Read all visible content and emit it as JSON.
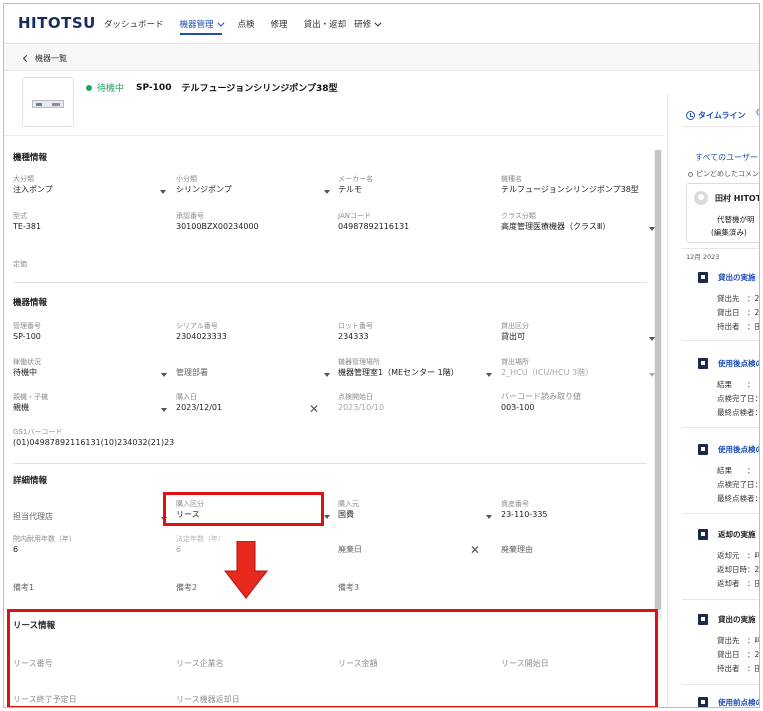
{
  "header": {
    "logo": "HITOTSU",
    "nav": [
      {
        "label": "ダッシュボード"
      },
      {
        "label": "機器管理"
      },
      {
        "label": "点検"
      },
      {
        "label": "修理"
      },
      {
        "label": "貸出・返却"
      },
      {
        "label": "研修"
      }
    ]
  },
  "subbar": {
    "back_label": "機器一覧"
  },
  "device": {
    "status": "待機中",
    "code": "SP-100",
    "name": "テルフュージョンシリンジポンプ38型"
  },
  "model_info": {
    "title": "機種情報",
    "fields": {
      "major_category": {
        "label": "大分類",
        "value": "注入ポンプ"
      },
      "minor_category": {
        "label": "小分類",
        "value": "シリンジポンプ"
      },
      "maker": {
        "label": "メーカー名",
        "value": "テルモ"
      },
      "model_name": {
        "label": "機種名",
        "value": "テルフュージョンシリンジポンプ38型"
      },
      "type": {
        "label": "型式",
        "value": "TE-381"
      },
      "approval_no": {
        "label": "承認番号",
        "value": "30100BZX00234000"
      },
      "jan": {
        "label": "JANコード",
        "value": "04987892116131"
      },
      "class": {
        "label": "クラス分類",
        "value": "高度管理医療機器（クラスⅢ）"
      },
      "price": {
        "label": "定価"
      }
    }
  },
  "device_info": {
    "title": "機器情報",
    "fields": {
      "mgmt_no": {
        "label": "管理番号",
        "value": "SP-100"
      },
      "serial": {
        "label": "シリアル番号",
        "value": "2304023333"
      },
      "lot": {
        "label": "ロット番号",
        "value": "234333"
      },
      "lending_cat": {
        "label": "貸出区分",
        "value": "貸出可"
      },
      "operation": {
        "label": "稼働状況",
        "value": "待機中"
      },
      "dept": {
        "label": "管理部署"
      },
      "location": {
        "label": "機器管理場所",
        "value": "機器管理室1（MEセンター 1階）"
      },
      "lend_place": {
        "label": "貸出場所",
        "value": "2_HCU（ICU/HCU 3階）"
      },
      "parent_child": {
        "label": "親機・子機",
        "value": "親機"
      },
      "purchase_date": {
        "label": "購入日",
        "value": "2023/12/01"
      },
      "inspect_start": {
        "label": "点検開始日",
        "value": "2023/10/10"
      },
      "barcode_read": {
        "label": "バーコード読み取り値",
        "value": "003-100"
      },
      "gs1": {
        "label": "GS1バーコード",
        "value": "(01)04987892116131(10)234032(21)23"
      }
    }
  },
  "detail_info": {
    "title": "詳細情報",
    "fields": {
      "agent": {
        "label": "担当代理店"
      },
      "purchase_type": {
        "label": "購入区分",
        "value": "リース"
      },
      "purchase_source": {
        "label": "購入元",
        "value": "国費"
      },
      "asset_no": {
        "label": "資産番号",
        "value": "23-110-335"
      },
      "durable_years": {
        "label": "院内耐用年数（年）",
        "value": "6"
      },
      "legal_years": {
        "label": "法定年数（年）",
        "value": "6"
      },
      "disposal_date": {
        "label": "廃棄日"
      },
      "disposal_reason": {
        "label": "廃棄理由"
      },
      "note1": {
        "label": "備考1"
      },
      "note2": {
        "label": "備考2"
      },
      "note3": {
        "label": "備考3"
      }
    }
  },
  "lease_info": {
    "title": "リース情報",
    "fields": {
      "lease_no": {
        "label": "リース番号"
      },
      "lease_company": {
        "label": "リース企業名"
      },
      "lease_amount": {
        "label": "リース金額"
      },
      "lease_start": {
        "label": "リース開始日"
      },
      "lease_end": {
        "label": "リース終了予定日"
      },
      "lease_return": {
        "label": "リース機器返却日"
      }
    }
  },
  "timeline": {
    "tab_label": "タイムライン",
    "tab2_label": "C",
    "all_users": "すべてのユーザー",
    "pinned_label": "ピンどめしたコメン",
    "comment": {
      "name": "田村 HITOT",
      "line1": "代替機が明",
      "line2": "(編集済み)"
    },
    "month": "12月 2023",
    "events": [
      {
        "title": "貸出の実施",
        "rows": [
          "貸出先　：2",
          "貸出日　：2",
          "持出者　：田"
        ]
      },
      {
        "title": "使用後点検の",
        "rows": [
          "結果　　：",
          "点検完了日：",
          "最終点検者："
        ]
      },
      {
        "title": "使用後点検の",
        "rows": [
          "結果　　：",
          "点検完了日：",
          "最終点検者："
        ]
      },
      {
        "title": "返却の実施",
        "rows": [
          "返却元　：吗",
          "返却日時：2",
          "返却者　：田"
        ]
      },
      {
        "title": "貸出の実施",
        "rows": [
          "貸出先　：吗",
          "貸出日　：2",
          "持出者　：田"
        ]
      },
      {
        "title": "使用前点検の",
        "rows": []
      }
    ]
  }
}
